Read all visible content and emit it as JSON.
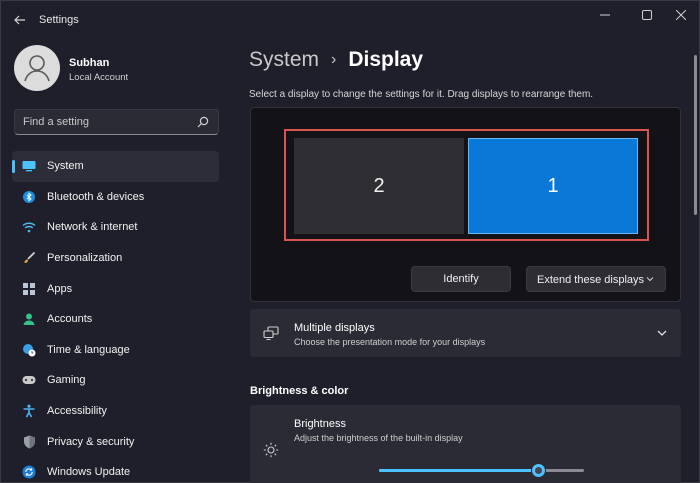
{
  "window": {
    "title": "Settings",
    "controls": {
      "minimize": "—",
      "maximize": "☐",
      "close": "✕"
    }
  },
  "profile": {
    "name": "Subhan",
    "account_type": "Local Account"
  },
  "search": {
    "placeholder": "Find a setting",
    "value": ""
  },
  "sidebar": {
    "items": [
      {
        "label": "System",
        "icon": "monitor-icon",
        "active": true
      },
      {
        "label": "Bluetooth & devices",
        "icon": "bluetooth-icon"
      },
      {
        "label": "Network & internet",
        "icon": "wifi-icon"
      },
      {
        "label": "Personalization",
        "icon": "brush-icon"
      },
      {
        "label": "Apps",
        "icon": "apps-icon"
      },
      {
        "label": "Accounts",
        "icon": "person-icon"
      },
      {
        "label": "Time & language",
        "icon": "globe-clock-icon"
      },
      {
        "label": "Gaming",
        "icon": "gamepad-icon"
      },
      {
        "label": "Accessibility",
        "icon": "accessibility-icon"
      },
      {
        "label": "Privacy & security",
        "icon": "shield-icon"
      },
      {
        "label": "Windows Update",
        "icon": "update-icon"
      }
    ]
  },
  "breadcrumb": {
    "parent": "System",
    "separator": "›",
    "current": "Display"
  },
  "main": {
    "description": "Select a display to change the settings for it. Drag displays to rearrange them.",
    "displays": [
      {
        "number": "2",
        "selected": false
      },
      {
        "number": "1",
        "selected": true
      }
    ],
    "identify_label": "Identify",
    "extend_label": "Extend these displays"
  },
  "multiple_displays": {
    "title": "Multiple displays",
    "subtitle": "Choose the presentation mode for your displays"
  },
  "brightness_section": {
    "heading": "Brightness & color",
    "title": "Brightness",
    "subtitle": "Adjust the brightness of the built-in display",
    "value_fraction": 0.78
  },
  "colors": {
    "accent": "#4cc2ff",
    "selected_display": "#0a78d6",
    "highlight_border": "#d9534f"
  }
}
